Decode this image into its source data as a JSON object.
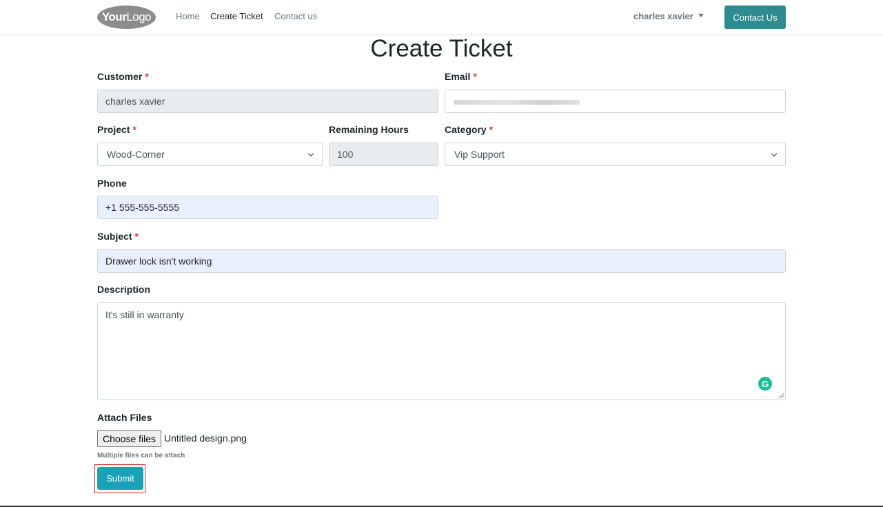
{
  "header": {
    "logo": {
      "bold": "Your",
      "light": "Logo"
    },
    "nav": [
      {
        "label": "Home",
        "active": false
      },
      {
        "label": "Create Ticket",
        "active": true
      },
      {
        "label": "Contact us",
        "active": false
      }
    ],
    "user_name": "charles xavier",
    "contact_button": "Contact Us"
  },
  "page": {
    "title": "Create Ticket"
  },
  "form": {
    "customer": {
      "label": "Customer",
      "required": "*",
      "value": "charles xavier"
    },
    "email": {
      "label": "Email",
      "required": "*",
      "value": ""
    },
    "project": {
      "label": "Project",
      "required": "*",
      "value": "Wood-Corner"
    },
    "remaining_hours": {
      "label": "Remaining Hours",
      "value": "100"
    },
    "category": {
      "label": "Category",
      "required": "*",
      "value": "Vip Support"
    },
    "phone": {
      "label": "Phone",
      "value": "+1 555-555-5555"
    },
    "subject": {
      "label": "Subject",
      "required": "*",
      "value": "Drawer lock isn't working"
    },
    "description": {
      "label": "Description",
      "value": "It's still in warranty"
    },
    "attach": {
      "label": "Attach Files",
      "button": "Choose files",
      "file_name": "Untitled design.png",
      "help": "Multiple files can be attach"
    },
    "submit": "Submit"
  },
  "icons": {
    "grammarly": "G"
  },
  "colors": {
    "primary_teal": "#2e8b90",
    "submit": "#17a2b8",
    "required": "#dc3545",
    "highlight_outline": "#d9262c"
  }
}
